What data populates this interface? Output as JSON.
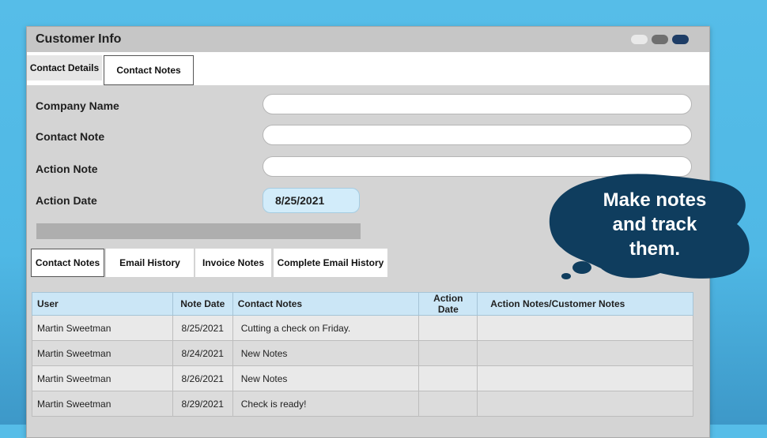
{
  "window": {
    "title": "Customer Info",
    "accent_colors": {
      "light": "#e9e9e9",
      "mid": "#6f6f6f",
      "dark": "#1e3d66"
    }
  },
  "top_tabs": [
    {
      "label": "Contact Details"
    },
    {
      "label": "Contact Notes"
    }
  ],
  "form": {
    "company_name_label": "Company Name",
    "company_name_value": "",
    "contact_note_label": "Contact Note",
    "contact_note_value": "",
    "action_note_label": "Action Note",
    "action_note_value": "",
    "action_date_label": "Action Date",
    "action_date_value": "8/25/2021"
  },
  "lower_tabs": [
    {
      "label": "Contact Notes"
    },
    {
      "label": "Email History"
    },
    {
      "label": "Invoice Notes"
    },
    {
      "label": "Complete Email History"
    }
  ],
  "table": {
    "columns": [
      "User",
      "Note Date",
      "Contact Notes",
      "Action Date",
      "Action Notes/Customer Notes"
    ],
    "rows": [
      [
        "Martin Sweetman",
        "8/25/2021",
        "Cutting a check on Friday.",
        "",
        ""
      ],
      [
        "Martin Sweetman",
        "8/24/2021",
        "New Notes",
        "",
        ""
      ],
      [
        "Martin Sweetman",
        "8/26/2021",
        "New Notes",
        "",
        ""
      ],
      [
        "Martin Sweetman",
        "8/29/2021",
        "Check is ready!",
        "",
        ""
      ]
    ]
  },
  "callout": {
    "line1": "Make notes",
    "line2": "and track",
    "line3": "them.",
    "color": "#0f3d5e"
  }
}
